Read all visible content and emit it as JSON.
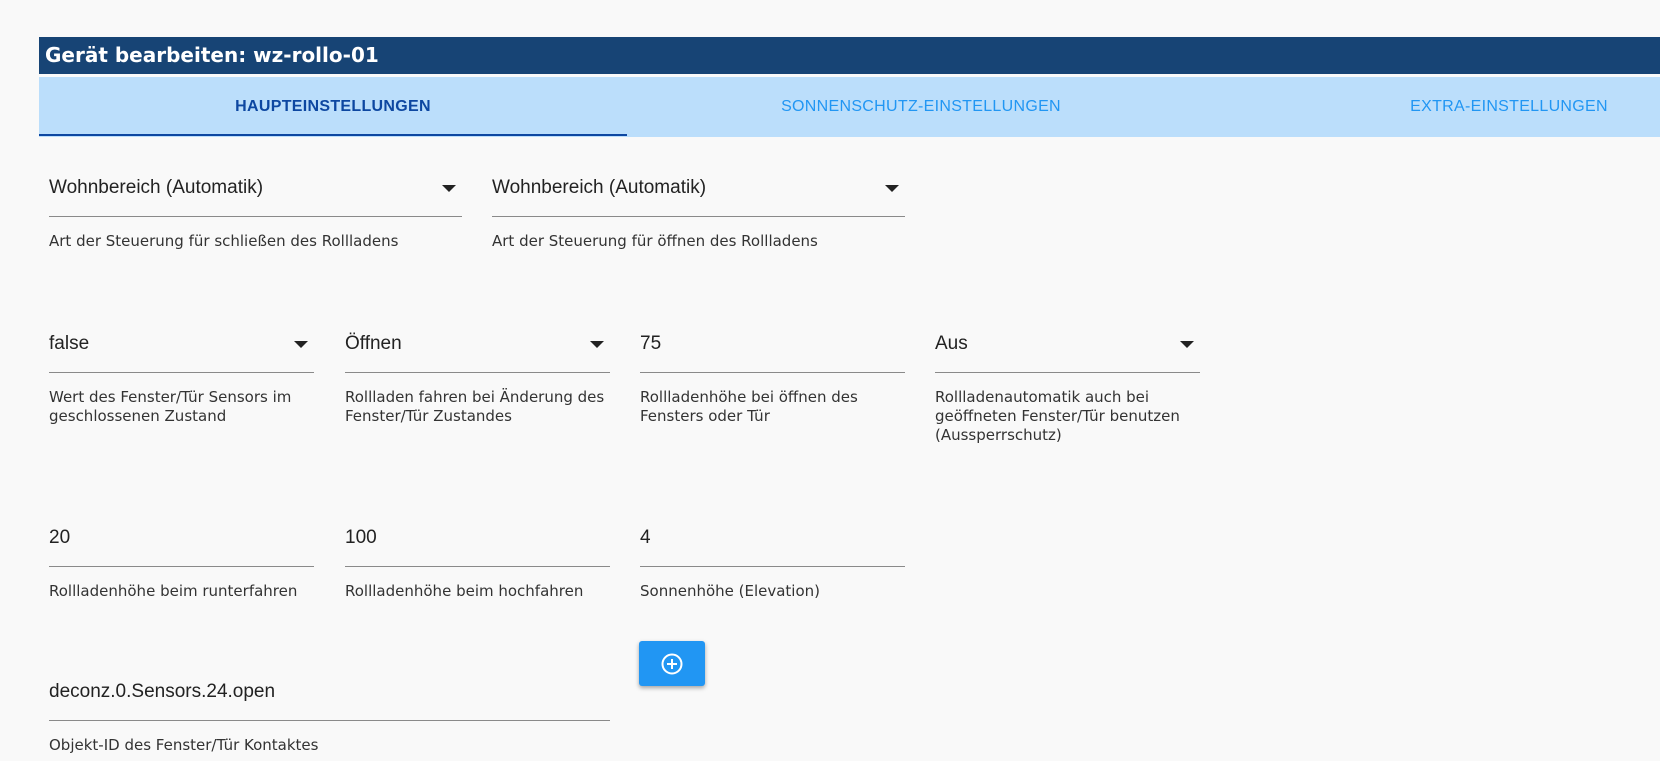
{
  "dialog": {
    "title": "Gerät bearbeiten: wz-rollo-01"
  },
  "tabs": [
    {
      "label": "HAUPTEINSTELLUNGEN",
      "active": true
    },
    {
      "label": "SONNENSCHUTZ-EINSTELLUNGEN",
      "active": false
    },
    {
      "label": "EXTRA-EINSTELLUNGEN",
      "active": false
    }
  ],
  "fields": {
    "close_control": {
      "value": "Wohnbereich (Automatik)",
      "helper": "Art der Steuerung für schließen des Rollladens"
    },
    "open_control": {
      "value": "Wohnbereich (Automatik)",
      "helper": "Art der Steuerung für öffnen des Rollladens"
    },
    "sensor_closed_value": {
      "value": "false",
      "helper": "Wert des Fenster/Tür Sensors im geschlossenen Zustand"
    },
    "drive_on_change": {
      "value": "Öffnen",
      "helper": "Rollladen fahren bei Änderung des Fenster/Tür Zustandes"
    },
    "height_on_open": {
      "value": "75",
      "helper": "Rollladenhöhe bei öffnen des Fensters oder Tür"
    },
    "lockout_protection": {
      "value": "Aus",
      "helper": "Rollladenautomatik auch bei geöffneten Fenster/Tür benutzen (Aussperrschutz)"
    },
    "height_down": {
      "value": "20",
      "helper": "Rollladenhöhe beim runterfahren"
    },
    "height_up": {
      "value": "100",
      "helper": "Rollladenhöhe beim hochfahren"
    },
    "sun_elevation": {
      "value": "4",
      "helper": "Sonnenhöhe (Elevation)"
    },
    "contact_object_id": {
      "value": "deconz.0.Sensors.24.open",
      "helper": "Objekt-ID des Fenster/Tür Kontaktes"
    }
  },
  "add_button": {
    "icon": "plus-circle-icon"
  },
  "colors": {
    "title_bar": "#174475",
    "tab_bar": "#bbdefb",
    "tab_active": "#0d47a1",
    "tab_inactive": "#2196f3",
    "button": "#2196f3"
  }
}
